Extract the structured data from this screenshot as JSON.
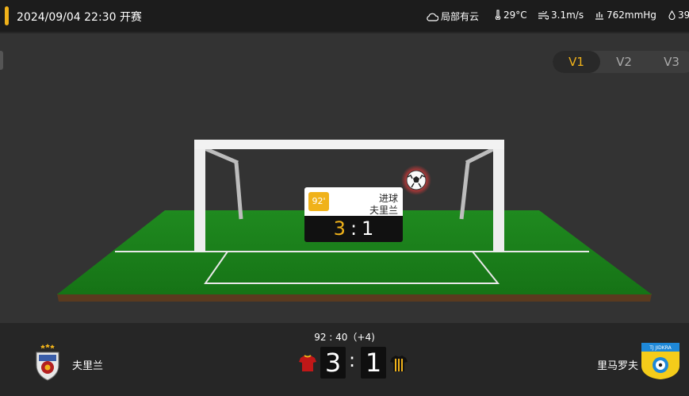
{
  "header": {
    "accent_color": "#f0b21a",
    "match_time": "2024/09/04 22:30 开赛",
    "weather": {
      "condition": "局部有云",
      "temperature": "29°C",
      "wind": "3.1m/s",
      "pressure": "762mmHg",
      "humidity": "39"
    }
  },
  "view_tabs": [
    {
      "label": "V1",
      "active": true
    },
    {
      "label": "V2",
      "active": false
    },
    {
      "label": "V3",
      "active": false
    }
  ],
  "event": {
    "minute": "92'",
    "type": "进球",
    "team": "夫里兰",
    "score_home": "3",
    "score_sep": ":",
    "score_away": "1"
  },
  "match": {
    "clock": "92 : 40（+4)",
    "home_team": "夫里兰",
    "away_team": "里马罗夫",
    "home_score": "3",
    "away_score": "1",
    "score_sep": ":",
    "away_logo_text": "TJ JIDKRA"
  }
}
